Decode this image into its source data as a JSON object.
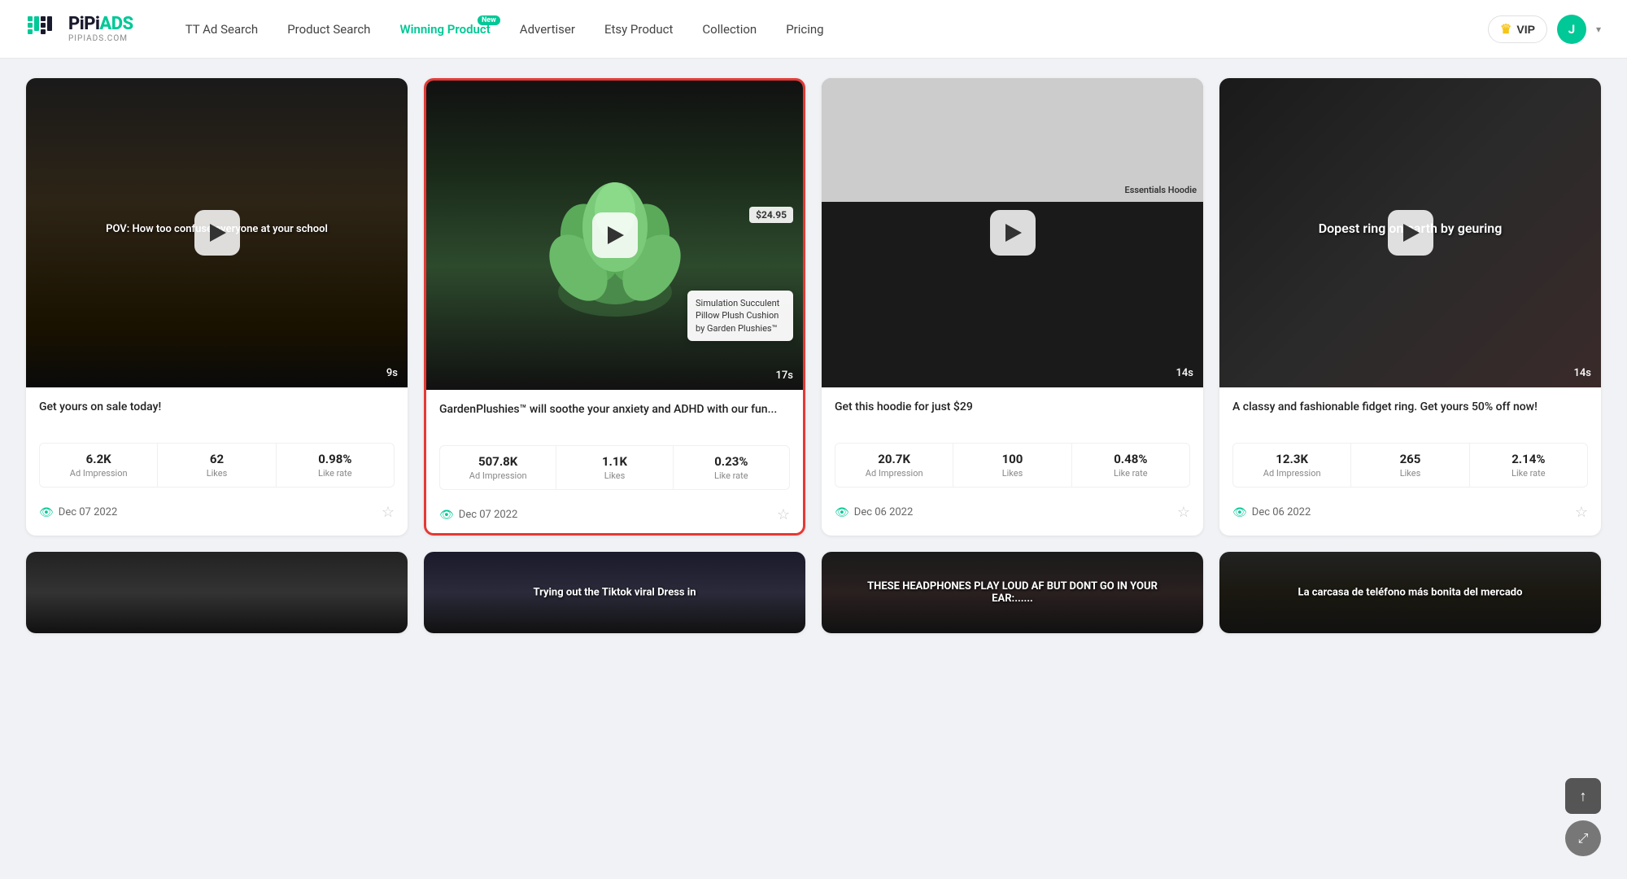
{
  "header": {
    "logo_top": "PiPiADS",
    "logo_bottom": "PIPIADS.COM",
    "nav_items": [
      {
        "id": "tt-ad-search",
        "label": "TT Ad Search",
        "active": false,
        "badge": null
      },
      {
        "id": "product-search",
        "label": "Product Search",
        "active": false,
        "badge": null
      },
      {
        "id": "winning-product",
        "label": "Winning Product",
        "active": true,
        "badge": "New"
      },
      {
        "id": "advertiser",
        "label": "Advertiser",
        "active": false,
        "badge": null
      },
      {
        "id": "etsy-product",
        "label": "Etsy Product",
        "active": false,
        "badge": null
      },
      {
        "id": "collection",
        "label": "Collection",
        "active": false,
        "badge": null
      },
      {
        "id": "pricing",
        "label": "Pricing",
        "active": false,
        "badge": null
      }
    ],
    "vip_label": "VIP",
    "avatar_initial": "J"
  },
  "cards": [
    {
      "id": "card-1",
      "title": "Get yours on sale today!",
      "duration": "9s",
      "overlay_text": "POV: How too confuse everyone at your school",
      "highlighted": false,
      "ad_impression": "6.2K",
      "likes": "62",
      "like_rate": "0.98%",
      "date": "Dec 07 2022",
      "has_price_tag": false,
      "has_tooltip": false,
      "thumb_class": "thumb-1"
    },
    {
      "id": "card-2",
      "title": "GardenPlushies™ will soothe your anxiety and ADHD with our fun...",
      "duration": "17s",
      "overlay_text": "",
      "highlighted": true,
      "price_tag": "$24.95",
      "product_tooltip": "Simulation Succulent Pillow Plush Cushion by Garden Plushies™",
      "ad_impression": "507.8K",
      "likes": "1.1K",
      "like_rate": "0.23%",
      "date": "Dec 07 2022",
      "has_price_tag": true,
      "has_tooltip": true,
      "thumb_class": "thumb-2"
    },
    {
      "id": "card-3",
      "title": "Get this hoodie for just $29",
      "duration": "14s",
      "overlay_text": "Essentials Hoodie",
      "highlighted": false,
      "ad_impression": "20.7K",
      "likes": "100",
      "like_rate": "0.48%",
      "date": "Dec 06 2022",
      "has_price_tag": false,
      "has_tooltip": false,
      "thumb_class": "thumb-3"
    },
    {
      "id": "card-4",
      "title": "A classy and fashionable fidget ring. Get yours 50% off now!",
      "duration": "14s",
      "overlay_text": "Dopest ring on earth by geuring",
      "highlighted": false,
      "ad_impression": "12.3K",
      "likes": "265",
      "like_rate": "2.14%",
      "date": "Dec 06 2022",
      "has_price_tag": false,
      "has_tooltip": false,
      "thumb_class": "thumb-4"
    }
  ],
  "bottom_cards": [
    {
      "id": "bc-1",
      "thumb_class": "thumb-5",
      "text": ""
    },
    {
      "id": "bc-2",
      "thumb_class": "thumb-6",
      "text": "Trying out the Tiktok viral Dress in"
    },
    {
      "id": "bc-3",
      "thumb_class": "thumb-7",
      "text": "THESE HEADPHONES PLAY LOUD AF BUT DONT GO IN YOUR EAR:......"
    },
    {
      "id": "bc-4",
      "thumb_class": "thumb-8",
      "text": "La carcasa de teléfono más bonita del mercado"
    }
  ],
  "stat_labels": {
    "ad_impression": "Ad Impression",
    "likes": "Likes",
    "like_rate": "Like rate"
  }
}
